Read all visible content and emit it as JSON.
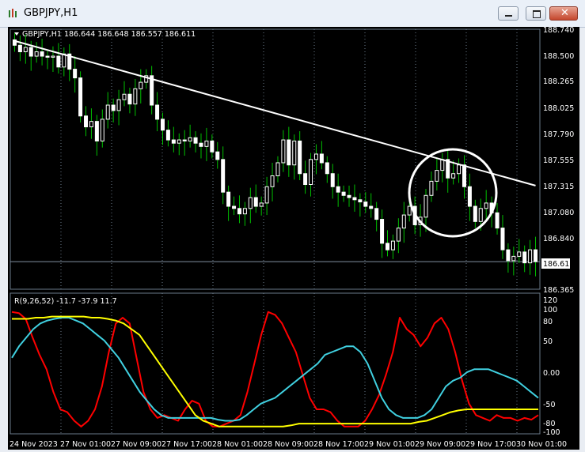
{
  "window": {
    "title": "GBPJPY,H1",
    "minimize_icon": "minimize-icon",
    "maximize_icon": "maximize-icon",
    "close_icon": "close-icon"
  },
  "main_chart": {
    "header": "GBPJPY,H1  186.644 186.648 186.557 186.611",
    "current_price_label": "186.611",
    "price_ticks": [
      "188.740",
      "188.500",
      "188.265",
      "188.025",
      "187.790",
      "187.555",
      "187.315",
      "187.080",
      "186.840",
      "186.611",
      "186.365"
    ]
  },
  "indicator": {
    "header": "R(9,26,52) -11.7 -37.9 11.7",
    "ticks": [
      "120",
      "100",
      "80",
      "50",
      "0.00",
      "-50",
      "-80",
      "-100"
    ]
  },
  "time_axis": [
    "24 Nov 2023",
    "27 Nov 01:00",
    "27 Nov 09:00",
    "27 Nov 17:00",
    "28 Nov 01:00",
    "28 Nov 09:00",
    "28 Nov 17:00",
    "29 Nov 01:00",
    "29 Nov 09:00",
    "29 Nov 17:00",
    "30 Nov 01:00"
  ],
  "colors": {
    "background": "#000000",
    "candle_bull": "#ffffff",
    "candle_wick": "#00c000",
    "trendline": "#ffffff",
    "annotation_circle": "#ffffff",
    "indicator_fast": "#ff0000",
    "indicator_mid": "#40d0e0",
    "indicator_slow": "#ffff00",
    "grid": "#6a7a8a"
  },
  "chart_data": [
    {
      "type": "candlestick",
      "title": "GBPJPY,H1",
      "ylim": [
        186.365,
        188.74
      ],
      "close_series": [
        188.6,
        188.54,
        188.58,
        188.5,
        188.54,
        188.5,
        188.49,
        188.5,
        188.4,
        188.52,
        188.38,
        188.3,
        187.95,
        187.85,
        187.9,
        187.72,
        187.92,
        188.05,
        188.0,
        188.1,
        188.15,
        188.06,
        188.2,
        188.26,
        188.32,
        188.05,
        187.92,
        187.82,
        187.73,
        187.7,
        187.73,
        187.72,
        187.75,
        187.7,
        187.67,
        187.72,
        187.62,
        187.55,
        187.25,
        187.12,
        187.1,
        187.05,
        187.1,
        187.2,
        187.12,
        187.15,
        187.3,
        187.4,
        187.52,
        187.73,
        187.5,
        187.72,
        187.42,
        187.32,
        187.55,
        187.6,
        187.52,
        187.42,
        187.3,
        187.25,
        187.22,
        187.2,
        187.18,
        187.16,
        187.12,
        187.1,
        187.0,
        186.78,
        186.72,
        186.8,
        186.92,
        187.04,
        187.12,
        186.95,
        187.02,
        187.22,
        187.35,
        187.45,
        187.55,
        187.38,
        187.42,
        187.5,
        187.3,
        187.12,
        186.98,
        187.1,
        187.15,
        187.06,
        186.92,
        186.72,
        186.62,
        186.66,
        186.7,
        186.6,
        186.72,
        186.611
      ],
      "trendline": {
        "from": [
          0,
          188.64
        ],
        "to": [
          95,
          187.31
        ]
      },
      "annotation": "circle"
    },
    {
      "type": "line",
      "title": "R(9,26,52)",
      "ylim": [
        -110,
        130
      ],
      "series": [
        {
          "values": [
            100,
            98,
            88,
            55,
            25,
            0,
            -40,
            -70,
            -75,
            -90,
            -100,
            -90,
            -70,
            -30,
            30,
            80,
            90,
            80,
            20,
            -40,
            -70,
            -85,
            -80,
            -85,
            -90,
            -70,
            -55,
            -60,
            -90,
            -100,
            -100,
            -95,
            -90,
            -80,
            -40,
            10,
            60,
            100,
            95,
            80,
            55,
            30,
            -10,
            -50,
            -70,
            -70,
            -75,
            -90,
            -100,
            -100,
            -100,
            -90,
            -70,
            -45,
            -10,
            30,
            90,
            70,
            60,
            40,
            55,
            80,
            90,
            70,
            30,
            -20,
            -60,
            -80,
            -85,
            -90,
            -80,
            -85,
            -85,
            -90,
            -85,
            -88,
            -80
          ]
        },
        {
          "values": [
            20,
            40,
            55,
            70,
            80,
            85,
            88,
            90,
            90,
            85,
            80,
            70,
            60,
            50,
            35,
            20,
            0,
            -20,
            -40,
            -55,
            -70,
            -80,
            -85,
            -85,
            -85,
            -85,
            -85,
            -85,
            -85,
            -88,
            -90,
            -90,
            -88,
            -80,
            -70,
            -60,
            -55,
            -50,
            -40,
            -30,
            -20,
            -10,
            0,
            10,
            25,
            30,
            35,
            40,
            40,
            30,
            10,
            -20,
            -50,
            -70,
            -80,
            -85,
            -85,
            -85,
            -80,
            -70,
            -50,
            -30,
            -20,
            -15,
            -5,
            0,
            0,
            0,
            -5,
            -10,
            -15,
            -20,
            -30,
            -40,
            -50
          ]
        },
        {
          "values": [
            88,
            88,
            88,
            90,
            90,
            92,
            92,
            92,
            92,
            92,
            90,
            90,
            88,
            85,
            80,
            70,
            60,
            40,
            20,
            0,
            -20,
            -40,
            -60,
            -80,
            -90,
            -95,
            -100,
            -100,
            -100,
            -100,
            -100,
            -100,
            -100,
            -100,
            -100,
            -98,
            -95,
            -95,
            -95,
            -95,
            -95,
            -95,
            -95,
            -95,
            -95,
            -95,
            -95,
            -95,
            -95,
            -95,
            -95,
            -92,
            -90,
            -85,
            -80,
            -75,
            -72,
            -70,
            -70,
            -70,
            -70,
            -70,
            -70,
            -70,
            -70,
            -70,
            -70
          ]
        }
      ]
    }
  ]
}
